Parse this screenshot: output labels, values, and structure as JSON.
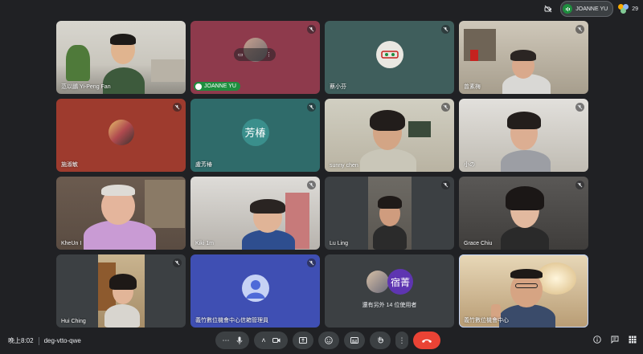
{
  "topbar": {
    "active_speaker": "JOANNE YU",
    "participant_count": "29"
  },
  "tiles": [
    {
      "name": "范以鵬 Yi-Peng Fan",
      "muted": false
    },
    {
      "name": "",
      "speaking_badge": "JOANNE YU",
      "muted": true
    },
    {
      "name": "蔡小芬",
      "muted": true
    },
    {
      "name": "曾素梅",
      "muted": true
    },
    {
      "name": "施淑敏",
      "muted": true
    },
    {
      "name": "盧芳椿",
      "avatar_text": "芳椿",
      "muted": true
    },
    {
      "name": "sunny chen",
      "muted": true
    },
    {
      "name": "小の",
      "muted": true
    },
    {
      "name": "KheUn I",
      "muted": true
    },
    {
      "name": "Kiki 1m",
      "muted": true
    },
    {
      "name": "Lu Ling",
      "muted": true
    },
    {
      "name": "Grace Chiu",
      "muted": true
    },
    {
      "name": "Hui Ching",
      "muted": true
    },
    {
      "name": "義竹數位機會中心信箱管理員",
      "muted": true
    },
    {
      "name": "",
      "others_text": "還有另外 14 位使用者",
      "avatar_text": "宿菁",
      "muted": false
    },
    {
      "name": "義竹數位機會中心",
      "muted": false
    }
  ],
  "bottombar": {
    "time": "晚上8:02",
    "meeting_code": "deg-vtto-qwe"
  },
  "colors": {
    "background": "#202124",
    "tile": "#3c4043",
    "leave": "#ea4335",
    "speaker_green": "#1e8e3e",
    "purple_avatar": "#5e35b1"
  },
  "icons": [
    "mic-off-icon",
    "mic-icon",
    "camera-icon",
    "present-icon",
    "emoji-icon",
    "captions-icon",
    "hand-icon",
    "more-icon",
    "end-call-icon",
    "info-icon",
    "chat-icon",
    "activities-icon",
    "people-icon"
  ]
}
